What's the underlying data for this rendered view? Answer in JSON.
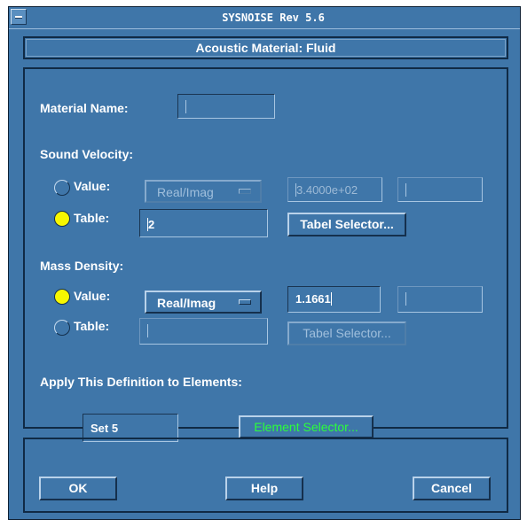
{
  "window": {
    "title": "SYSNOISE Rev 5.6"
  },
  "dialog": {
    "title": "Acoustic Material: Fluid"
  },
  "material_name": {
    "label": "Material Name:",
    "value": ""
  },
  "sound_velocity": {
    "section_label": "Sound Velocity:",
    "value_option": {
      "label": "Value:",
      "selected": false
    },
    "table_option": {
      "label": "Table:",
      "selected": true
    },
    "mode_menu": {
      "selected": "Real/Imag"
    },
    "real_value": "3.4000e+02",
    "imag_value": "",
    "table_value": "2",
    "table_selector_label": "Tabel Selector..."
  },
  "mass_density": {
    "section_label": "Mass Density:",
    "value_option": {
      "label": "Value:",
      "selected": true
    },
    "table_option": {
      "label": "Table:",
      "selected": false
    },
    "mode_menu": {
      "selected": "Real/Imag"
    },
    "real_value": "1.1661",
    "imag_value": "",
    "table_value": "",
    "table_selector_label": "Tabel Selector..."
  },
  "apply": {
    "label": "Apply This Definition to Elements:",
    "set_value": "Set 5",
    "element_selector_label": "Element Selector..."
  },
  "footer": {
    "ok_label": "OK",
    "help_label": "Help",
    "cancel_label": "Cancel"
  },
  "colors": {
    "background": "#3f76a9",
    "radio_selected": "#f7f700",
    "element_selector_text": "#2bff3a"
  }
}
